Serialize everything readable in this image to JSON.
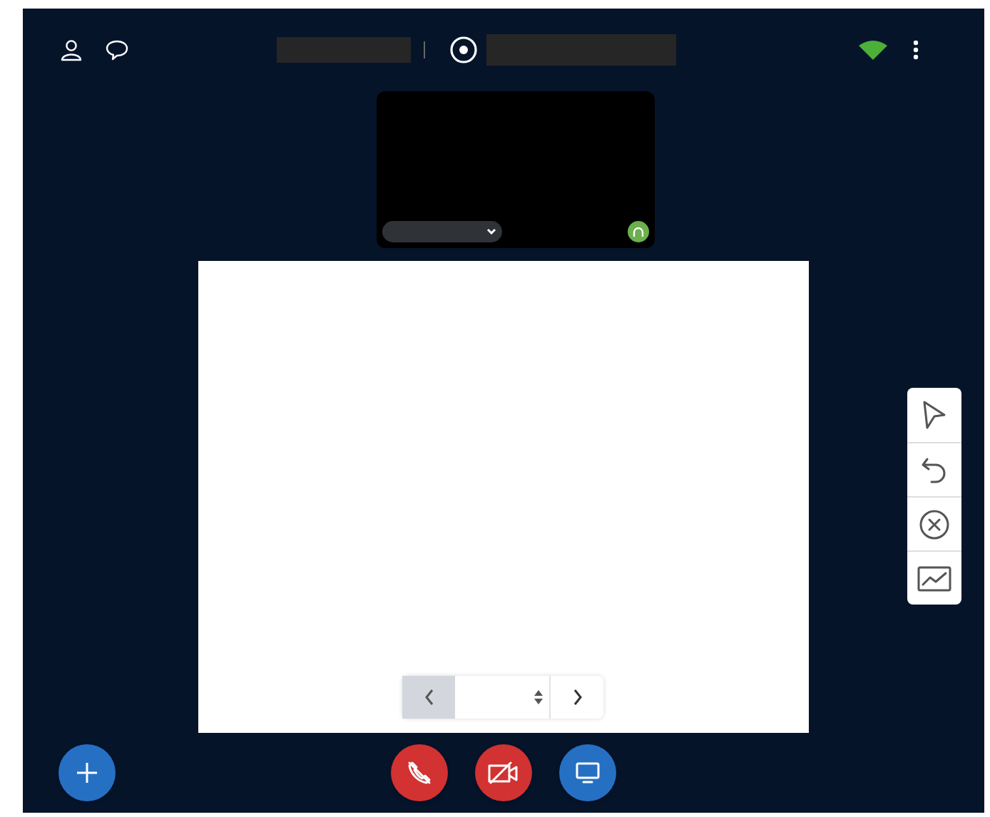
{
  "pager": {
    "previous_disabled": true
  },
  "tools": [
    {
      "kind": "pointer"
    },
    {
      "kind": "undo"
    },
    {
      "kind": "clear"
    },
    {
      "kind": "chart"
    }
  ],
  "call_controls": [
    {
      "kind": "hangup"
    },
    {
      "kind": "video-off"
    },
    {
      "kind": "screen-share"
    }
  ]
}
